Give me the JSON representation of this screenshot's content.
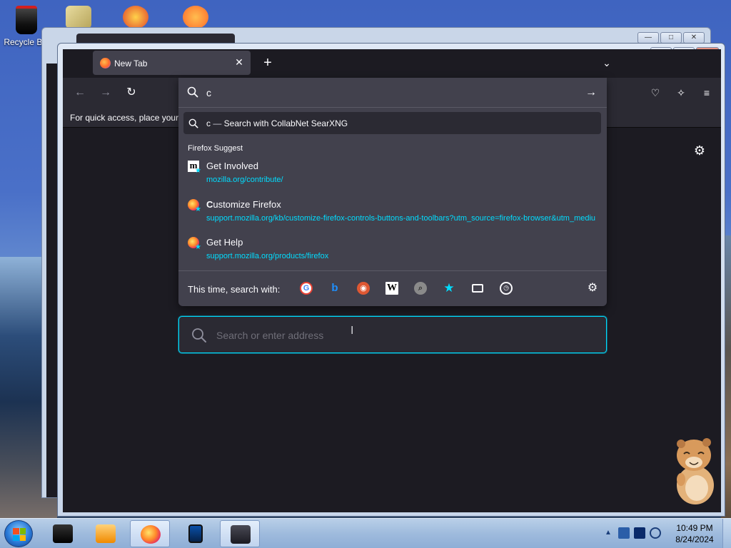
{
  "desktop": {
    "recycle_bin_label": "Recycle Bin"
  },
  "window": {
    "minimize": "—",
    "maximize": "□",
    "close": "✕"
  },
  "tabs": [
    {
      "title": "New Tab",
      "close": "✕"
    }
  ],
  "tabstrip": {
    "new_tab": "+",
    "list_all_tabs": "⌄"
  },
  "toolbar": {
    "back": "←",
    "forward": "→",
    "reload": "↻",
    "pocket": "♡",
    "extensions": "✧",
    "menu": "≡"
  },
  "bookmarks_bar": {
    "message": "For quick access, place your bookmarks here on the bookmarks toolbar."
  },
  "urlbar": {
    "typed_value": "c",
    "go": "→",
    "heuristic": {
      "query": "c",
      "dash": " — ",
      "action": "Search with CollabNet SearXNG"
    },
    "group_label": "Firefox Suggest",
    "suggestions": [
      {
        "icon": "mozilla-m-icon",
        "title_bold": "",
        "title_rest": "Get Involved",
        "url": "mozilla.org/contribute/"
      },
      {
        "icon": "firefox-icon",
        "title_bold": "C",
        "title_rest": "ustomize Firefox",
        "url": "support.mozilla.org/kb/customize-firefox-controls-buttons-and-toolbars?utm_source=firefox-browser&utm_medium=default-bookmarks"
      },
      {
        "icon": "firefox-icon",
        "title_bold": "",
        "title_rest": "Get Help",
        "url": "support.mozilla.org/products/firefox"
      }
    ],
    "oneoff_label": "This time, search with:",
    "engines": [
      {
        "name": "google-icon",
        "glyph": "G"
      },
      {
        "name": "bing-icon",
        "glyph": "b"
      },
      {
        "name": "duckduckgo-icon",
        "glyph": "◉"
      },
      {
        "name": "wikipedia-icon",
        "glyph": "W"
      },
      {
        "name": "searxng-icon",
        "glyph": "⌕"
      },
      {
        "name": "bookmarks-icon",
        "glyph": "★"
      },
      {
        "name": "tabs-icon",
        "glyph": ""
      },
      {
        "name": "history-icon",
        "glyph": "◷"
      }
    ]
  },
  "newtab": {
    "search_placeholder": "Search or enter address",
    "settings_gear": "⚙"
  },
  "taskbar": {
    "time": "10:49 PM",
    "date": "8/24/2024",
    "tray_expand": "▲"
  },
  "colors": {
    "accent": "#00ddff",
    "toolbar_bg": "#2b2a33",
    "panel_bg": "#42414d",
    "page_bg": "#1c1b22"
  }
}
